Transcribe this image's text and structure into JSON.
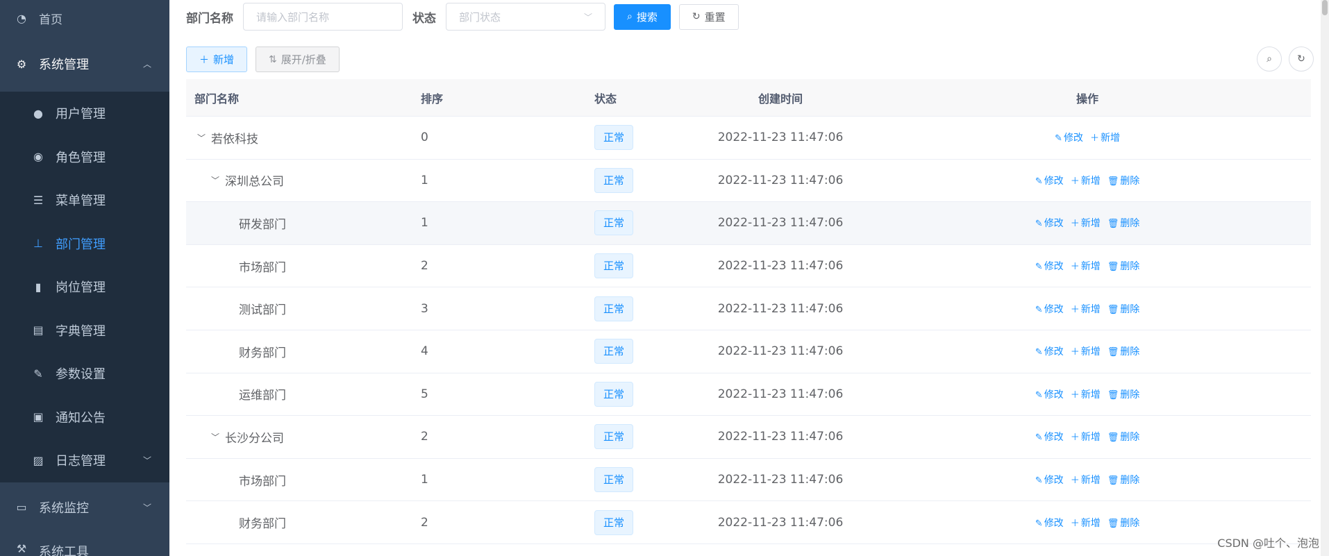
{
  "sidebar": {
    "home": "首页",
    "system": "系统管理",
    "items": [
      {
        "label": "用户管理",
        "icon": "user-icon"
      },
      {
        "label": "角色管理",
        "icon": "peoples-icon"
      },
      {
        "label": "菜单管理",
        "icon": "tree-table-icon"
      },
      {
        "label": "部门管理",
        "icon": "tree-icon"
      },
      {
        "label": "岗位管理",
        "icon": "post-icon"
      },
      {
        "label": "字典管理",
        "icon": "dict-icon"
      },
      {
        "label": "参数设置",
        "icon": "edit-icon"
      },
      {
        "label": "通知公告",
        "icon": "message-icon"
      },
      {
        "label": "日志管理",
        "icon": "log-icon"
      }
    ],
    "monitor": "系统监控",
    "tools": "系统工具"
  },
  "search": {
    "name_label": "部门名称",
    "name_placeholder": "请输入部门名称",
    "status_label": "状态",
    "status_placeholder": "部门状态",
    "search_btn": "搜索",
    "reset_btn": "重置"
  },
  "toolbar": {
    "add_btn": "新增",
    "expand_btn": "展开/折叠"
  },
  "table": {
    "headers": {
      "name": "部门名称",
      "sort": "排序",
      "status": "状态",
      "time": "创建时间",
      "ops": "操作"
    },
    "ops": {
      "edit": "修改",
      "add": "新增",
      "delete": "删除"
    },
    "rows": [
      {
        "name": "若依科技",
        "sort": "0",
        "status": "正常",
        "time": "2022-11-23 11:47:06",
        "level": 0,
        "expandable": true,
        "delete": false
      },
      {
        "name": "深圳总公司",
        "sort": "1",
        "status": "正常",
        "time": "2022-11-23 11:47:06",
        "level": 1,
        "expandable": true,
        "delete": true
      },
      {
        "name": "研发部门",
        "sort": "1",
        "status": "正常",
        "time": "2022-11-23 11:47:06",
        "level": 2,
        "expandable": false,
        "delete": true
      },
      {
        "name": "市场部门",
        "sort": "2",
        "status": "正常",
        "time": "2022-11-23 11:47:06",
        "level": 2,
        "expandable": false,
        "delete": true
      },
      {
        "name": "测试部门",
        "sort": "3",
        "status": "正常",
        "time": "2022-11-23 11:47:06",
        "level": 2,
        "expandable": false,
        "delete": true
      },
      {
        "name": "财务部门",
        "sort": "4",
        "status": "正常",
        "time": "2022-11-23 11:47:06",
        "level": 2,
        "expandable": false,
        "delete": true
      },
      {
        "name": "运维部门",
        "sort": "5",
        "status": "正常",
        "time": "2022-11-23 11:47:06",
        "level": 2,
        "expandable": false,
        "delete": true
      },
      {
        "name": "长沙分公司",
        "sort": "2",
        "status": "正常",
        "time": "2022-11-23 11:47:06",
        "level": 1,
        "expandable": true,
        "delete": true
      },
      {
        "name": "市场部门",
        "sort": "1",
        "status": "正常",
        "time": "2022-11-23 11:47:06",
        "level": 2,
        "expandable": false,
        "delete": true
      },
      {
        "name": "财务部门",
        "sort": "2",
        "status": "正常",
        "time": "2022-11-23 11:47:06",
        "level": 2,
        "expandable": false,
        "delete": true
      }
    ]
  },
  "watermark": "CSDN @吐个、泡泡",
  "colors": {
    "sidebar_bg": "#304156",
    "submenu_bg": "#1f2d3d",
    "primary": "#1890ff"
  }
}
